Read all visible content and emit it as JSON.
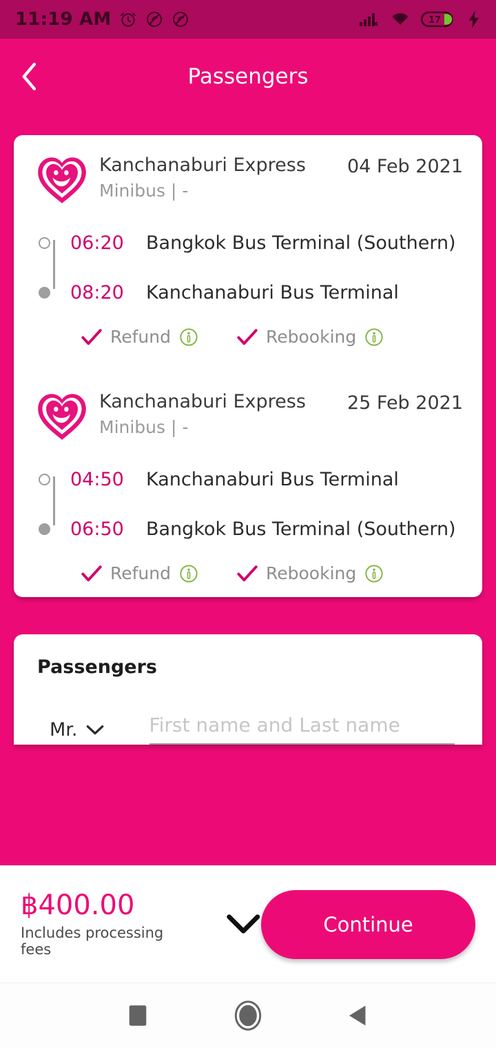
{
  "status_bar": {
    "time": "11:19 AM",
    "icons": [
      "alarm-icon",
      "silent-icon",
      "vibrate-off-icon"
    ],
    "signal_icon": "cellular-signal-icon",
    "wifi_icon": "wifi-icon",
    "battery_level": "17",
    "charging_icon": "charging-bolt-icon",
    "bg_color": "#ab0a5d"
  },
  "header": {
    "title": "Passengers",
    "back_icon": "chevron-left-icon",
    "bg_color": "#ec0b76"
  },
  "trips": [
    {
      "logo": "smiley-heart-logo",
      "operator": "Kanchanaburi Express",
      "vehicle": "Minibus | -",
      "date": "04 Feb 2021",
      "legs": [
        {
          "time": "06:20",
          "place": "Bangkok Bus Terminal (Southern)",
          "dot": "hollow"
        },
        {
          "time": "08:20",
          "place": "Kanchanaburi Bus Terminal",
          "dot": "filled"
        }
      ],
      "perks": [
        {
          "label": "Refund",
          "check_icon": "check-icon",
          "info_icon": "info-icon"
        },
        {
          "label": "Rebooking",
          "check_icon": "check-icon",
          "info_icon": "info-icon"
        }
      ]
    },
    {
      "logo": "smiley-heart-logo",
      "operator": "Kanchanaburi Express",
      "vehicle": "Minibus | -",
      "date": "25 Feb 2021",
      "legs": [
        {
          "time": "04:50",
          "place": "Kanchanaburi Bus Terminal",
          "dot": "hollow"
        },
        {
          "time": "06:50",
          "place": "Bangkok Bus Terminal (Southern)",
          "dot": "filled"
        }
      ],
      "perks": [
        {
          "label": "Refund",
          "check_icon": "check-icon",
          "info_icon": "info-icon"
        },
        {
          "label": "Rebooking",
          "check_icon": "check-icon",
          "info_icon": "info-icon"
        }
      ]
    }
  ],
  "passengers_section": {
    "title": "Passengers",
    "rows": [
      {
        "title_value": "Mr.",
        "title_chevron": "chevron-down-icon",
        "name_placeholder": "First name and Last name",
        "name_value": ""
      }
    ]
  },
  "bottom_bar": {
    "price": "฿400.00",
    "price_note": "Includes processing fees",
    "expand_icon": "chevron-down-icon",
    "continue_label": "Continue",
    "accent_color": "#ec0b76"
  },
  "nav_bar": {
    "recents_icon": "square-icon",
    "home_icon": "circle-icon",
    "back_icon": "triangle-back-icon"
  }
}
